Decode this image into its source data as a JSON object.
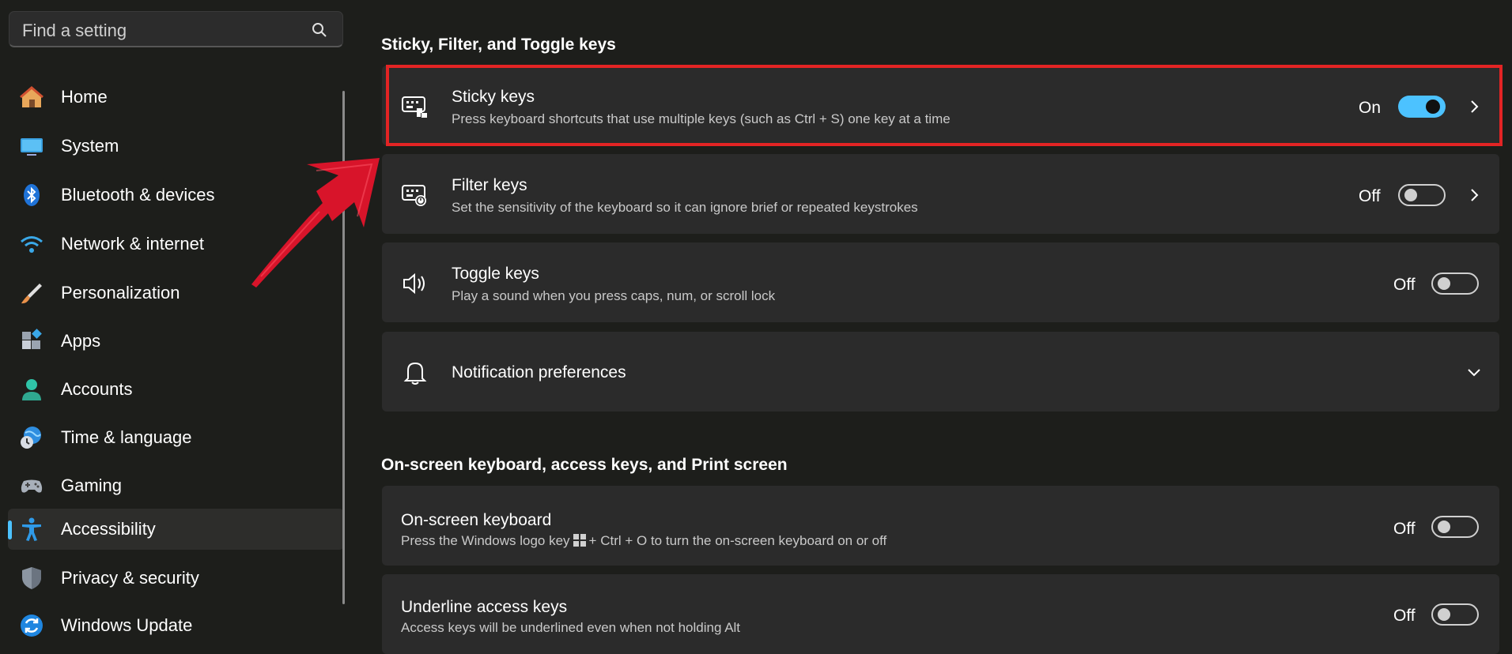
{
  "search": {
    "placeholder": "Find a setting"
  },
  "sidebar": {
    "items": [
      {
        "label": "Home",
        "icon": "home-icon"
      },
      {
        "label": "System",
        "icon": "system-icon"
      },
      {
        "label": "Bluetooth & devices",
        "icon": "bluetooth-icon"
      },
      {
        "label": "Network & internet",
        "icon": "wifi-icon"
      },
      {
        "label": "Personalization",
        "icon": "brush-icon"
      },
      {
        "label": "Apps",
        "icon": "apps-icon"
      },
      {
        "label": "Accounts",
        "icon": "accounts-icon"
      },
      {
        "label": "Time & language",
        "icon": "globe-clock-icon"
      },
      {
        "label": "Gaming",
        "icon": "gamepad-icon"
      },
      {
        "label": "Accessibility",
        "icon": "accessibility-icon",
        "selected": true
      },
      {
        "label": "Privacy & security",
        "icon": "shield-icon"
      },
      {
        "label": "Windows Update",
        "icon": "update-icon"
      }
    ]
  },
  "sections": [
    {
      "title": "Sticky, Filter, and Toggle keys",
      "cards": [
        {
          "title": "Sticky keys",
          "description": "Press keyboard shortcuts that use multiple keys (such as Ctrl + S) one key at a time",
          "state": "On",
          "icon": "sticky-keys-icon"
        },
        {
          "title": "Filter keys",
          "description": "Set the sensitivity of the keyboard so it can ignore brief or repeated keystrokes",
          "state": "Off",
          "icon": "filter-keys-icon"
        },
        {
          "title": "Toggle keys",
          "description": "Play a sound when you press caps, num, or scroll lock",
          "state": "Off",
          "icon": "speaker-icon"
        },
        {
          "title": "Notification preferences",
          "icon": "bell-icon"
        }
      ]
    },
    {
      "title": "On-screen keyboard, access keys, and Print screen",
      "cards": [
        {
          "title": "On-screen keyboard",
          "description_before": "Press the Windows logo key",
          "description_after": "+ Ctrl + O to turn the on-screen keyboard on or off",
          "state": "Off"
        },
        {
          "title": "Underline access keys",
          "description": "Access keys will be underlined even when not holding Alt",
          "state": "Off"
        }
      ]
    }
  ],
  "colors": {
    "accent": "#4cc2ff",
    "highlight_border": "#e32424",
    "arrow": "#d8142a"
  }
}
